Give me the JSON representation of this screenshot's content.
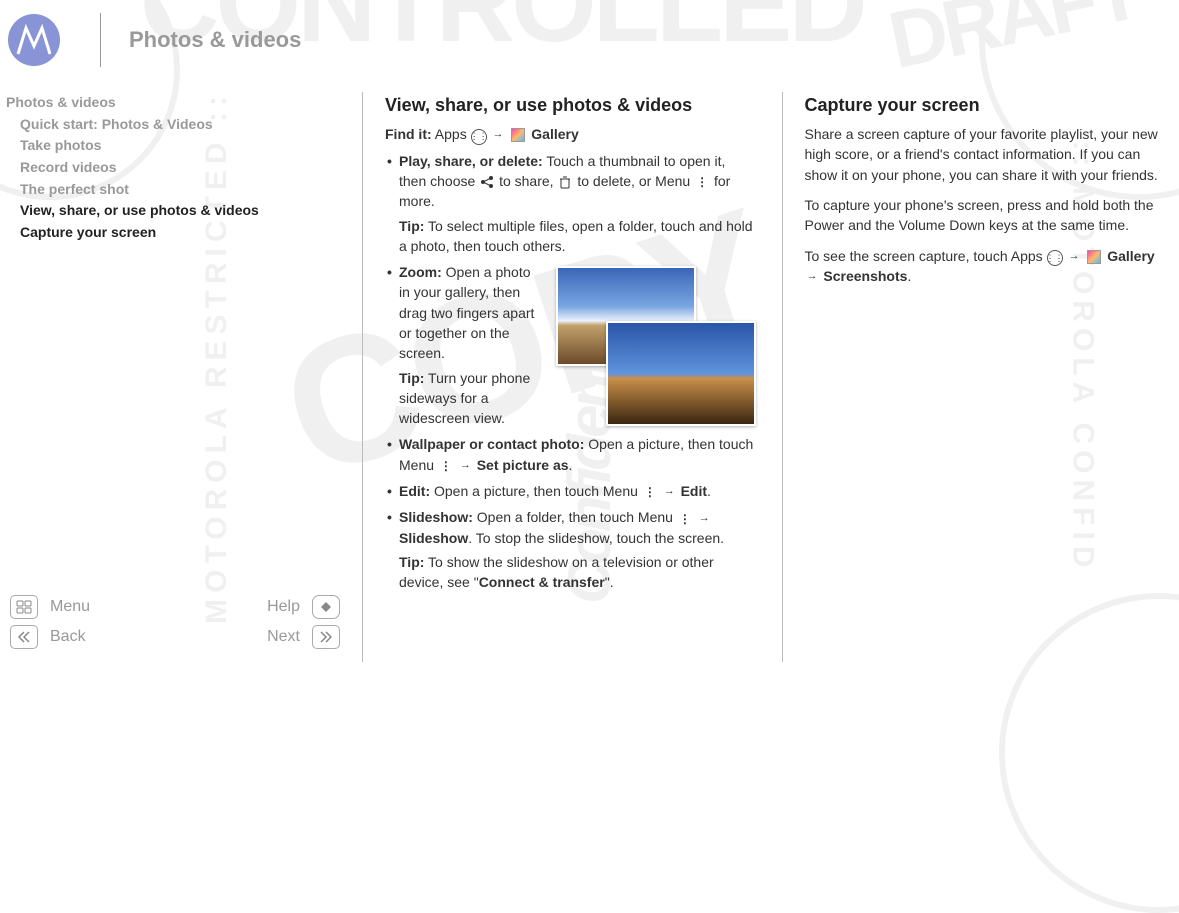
{
  "header": {
    "title": "Photos & videos"
  },
  "toc": {
    "section": "Photos & videos",
    "items": [
      "Quick start: Photos & Videos",
      "Take photos",
      "Record videos",
      "The perfect shot",
      "View, share, or use photos & videos",
      "Capture your screen"
    ],
    "active": "View, share, or use photos & videos"
  },
  "nav": {
    "menu": "Menu",
    "help": "Help",
    "back": "Back",
    "next": "Next"
  },
  "col1": {
    "heading": "View, share, or use photos & videos",
    "findit_label": "Find it:",
    "findit_prefix": "Apps",
    "findit_suffix": "Gallery",
    "play": {
      "title": "Play, share, or delete:",
      "text1": "Touch a thumbnail to open it, then choose",
      "text_share": "to share,",
      "text_delete": "to delete, or Menu",
      "text_more": "for more.",
      "tip_label": "Tip:",
      "tip_text": "To select multiple files, open a folder, touch and hold a photo, then touch others."
    },
    "zoom": {
      "title": "Zoom:",
      "text": "Open a photo in your gallery, then drag two fingers apart or together on the screen.",
      "tip_label": "Tip:",
      "tip_text": "Turn your phone sideways for a widescreen view."
    },
    "wallpaper": {
      "title": "Wallpaper or contact photo:",
      "text": "Open a picture, then touch Menu",
      "action": "Set picture as"
    },
    "edit": {
      "title": "Edit:",
      "text": "Open a picture, then touch Menu",
      "action": "Edit"
    },
    "slideshow": {
      "title": "Slideshow:",
      "text": "Open a folder, then touch Menu",
      "action": "Slideshow",
      "text2": "To stop the slideshow, touch the screen.",
      "tip_label": "Tip:",
      "tip_text_a": "To show the slideshow on a television or other device, see \"",
      "tip_link": "Connect & transfer",
      "tip_text_b": "\"."
    }
  },
  "col2": {
    "heading": "Capture your screen",
    "p1": "Share a screen capture of your favorite playlist, your new high score, or a friend's contact information. If you can show it on your phone, you can share it with your friends.",
    "p2": "To capture your phone's screen, press and hold both the Power and the Volume Down keys at the same time.",
    "p3a": "To see the screen capture, touch Apps",
    "p3b": "Gallery",
    "p3c": "Screenshots"
  }
}
